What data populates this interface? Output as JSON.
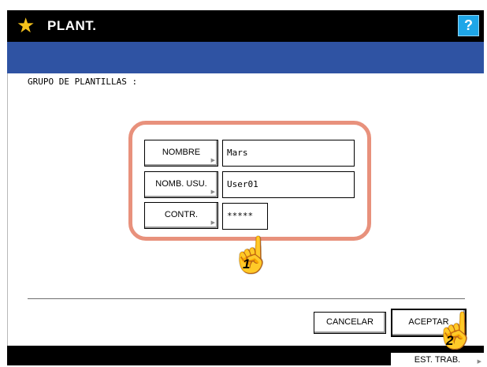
{
  "window": {
    "title": "PLANT.",
    "star_icon": "star-icon",
    "help_label": "?"
  },
  "main": {
    "group_label": "GRUPO DE PLANTILLAS :",
    "fields": [
      {
        "button_label": "NOMBRE",
        "value": "Mars"
      },
      {
        "button_label": "NOMB. USU.",
        "value": "User01"
      },
      {
        "button_label": "CONTR.",
        "value": "*****"
      }
    ]
  },
  "callouts": [
    "1",
    "2"
  ],
  "actions": {
    "cancel_label": "CANCELAR",
    "accept_label": "ACEPTAR"
  },
  "footer": {
    "status_label": "EST. TRAB."
  },
  "colors": {
    "title_bar": "#000000",
    "sub_bar": "#2f53a3",
    "help_button": "#1ea6e8",
    "star": "#f5c21b",
    "highlight_border": "#e8917c"
  }
}
